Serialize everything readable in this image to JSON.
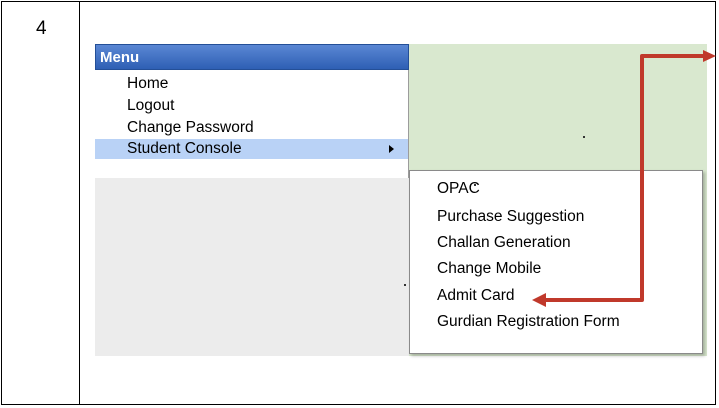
{
  "row_number": "4",
  "menu": {
    "title": "Menu",
    "items": [
      {
        "label": "Home"
      },
      {
        "label": "Logout"
      },
      {
        "label": "Change Password"
      },
      {
        "label": "Student Console"
      }
    ]
  },
  "submenu": {
    "items": [
      {
        "label": "OPAC"
      },
      {
        "label": "Purchase Suggestion"
      },
      {
        "label": "Challan Generation"
      },
      {
        "label": "Change Mobile"
      },
      {
        "label": "Admit Card"
      },
      {
        "label": "Gurdian Registration Form"
      }
    ]
  },
  "colors": {
    "menu_header": "#2e5fb4",
    "selected_item": "#b9d2f6",
    "content_bg": "#d9e8cf",
    "annotation_arrow": "#c0392b"
  },
  "icons": {
    "submenu_indicator": "triangle-right-icon",
    "annotation": "arrow-pointer-icon"
  }
}
